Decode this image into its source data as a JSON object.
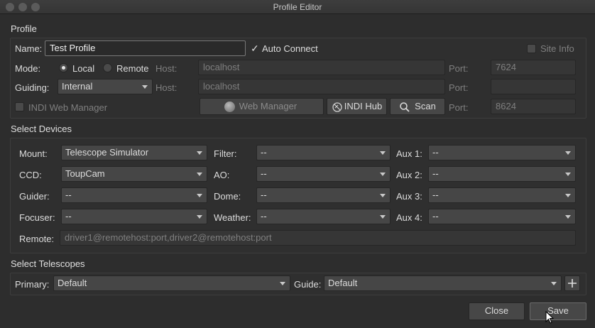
{
  "window": {
    "title": "Profile Editor"
  },
  "profile": {
    "section": "Profile",
    "name_label": "Name:",
    "name_value": "Test Profile",
    "auto_connect": "Auto Connect",
    "auto_connect_check": "✓",
    "site_info": "Site Info",
    "mode_label": "Mode:",
    "local": "Local",
    "remote": "Remote",
    "host_label": "Host:",
    "host1": "localhost",
    "port_label": "Port:",
    "port1": "7624",
    "guiding_label": "Guiding:",
    "guiding_value": "Internal",
    "host2": "localhost",
    "port2": "",
    "indi_web_manager": "INDI Web Manager",
    "web_manager_button": "Web Manager",
    "indi_hub_button": "INDI Hub",
    "scan_button": "Scan",
    "port3": "8624"
  },
  "devices": {
    "section": "Select Devices",
    "mount_label": "Mount:",
    "mount": "Telescope Simulator",
    "ccd_label": "CCD:",
    "ccd": "ToupCam",
    "guider_label": "Guider:",
    "guider": "--",
    "focuser_label": "Focuser:",
    "focuser": "--",
    "filter_label": "Filter:",
    "filter": "--",
    "ao_label": "AO:",
    "ao": "--",
    "dome_label": "Dome:",
    "dome": "--",
    "weather_label": "Weather:",
    "weather": "--",
    "aux1_label": "Aux 1:",
    "aux1": "--",
    "aux2_label": "Aux 2:",
    "aux2": "--",
    "aux3_label": "Aux 3:",
    "aux3": "--",
    "aux4_label": "Aux 4:",
    "aux4": "--",
    "remote_label": "Remote:",
    "remote_placeholder": "driver1@remotehost:port,driver2@remotehost:port"
  },
  "telescopes": {
    "section": "Select Telescopes",
    "primary_label": "Primary:",
    "primary": "Default",
    "guide_label": "Guide:",
    "guide": "Default"
  },
  "footer": {
    "close": "Close",
    "save": "Save"
  }
}
